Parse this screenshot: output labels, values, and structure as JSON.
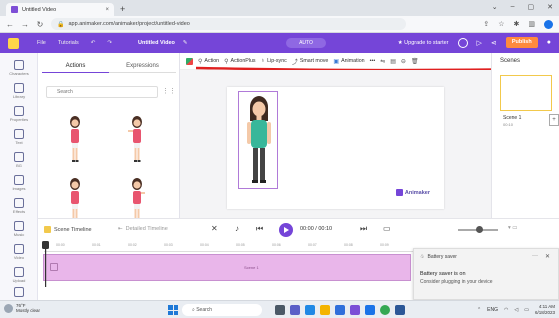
{
  "browser": {
    "tab_title": "Untitled Video",
    "tab_close": "×",
    "new_tab": "+",
    "window_controls": [
      "⌄",
      "–",
      "▢",
      "✕"
    ],
    "url": "app.animaker.com/animaker/project/untitled-video",
    "nav_icons": [
      "back-icon",
      "forward-icon",
      "reload-icon"
    ]
  },
  "app_header": {
    "menu": [
      "File",
      "Tutorials"
    ],
    "video_title": "Untitled Video",
    "pill": "AUTO",
    "upgrade": "Upgrade to starter",
    "publish": "Publish"
  },
  "left_rail": {
    "items": [
      "Characters",
      "Library",
      "Properties",
      "Text",
      "BG",
      "Images",
      "Effects",
      "Music",
      "Video",
      "Upload",
      "More"
    ]
  },
  "actions_panel": {
    "tabs": [
      "Actions",
      "Expressions"
    ],
    "active_tab": "Actions",
    "search_placeholder": "Search"
  },
  "toolbar": {
    "items": [
      "Action",
      "ActionPlus",
      "Lip-sync",
      "Smart move",
      "Animation"
    ],
    "more": "•••"
  },
  "scenes": {
    "label": "Scenes",
    "scene_name": "Scene 1",
    "scene_time": "00:10",
    "add": "+"
  },
  "canvas": {
    "watermark": "Animaker"
  },
  "timeline": {
    "scene_timeline": "Scene Timeline",
    "detailed_timeline": "Detailed Timeline",
    "current_time": "00:00 / 00:10",
    "ruler_ticks": [
      "00:00",
      "00:01",
      "00:02",
      "00:03",
      "00:04",
      "00:05",
      "00:06",
      "00:07",
      "00:08",
      "00:09"
    ],
    "track_label": "Scene 1"
  },
  "notification": {
    "app": "Battery saver",
    "title": "Battery saver is on",
    "body": "Consider plugging in your device"
  },
  "taskbar": {
    "weather_temp": "76°F",
    "weather_desc": "Mostly clear",
    "search": "Search",
    "tray_lang": "ENG",
    "time": "4:11 AM",
    "date": "6/18/2023"
  },
  "colors": {
    "brand": "#7545d8",
    "publish": "#ff8a3d",
    "track": "#e9b6ea",
    "annotation": "#e02020"
  }
}
